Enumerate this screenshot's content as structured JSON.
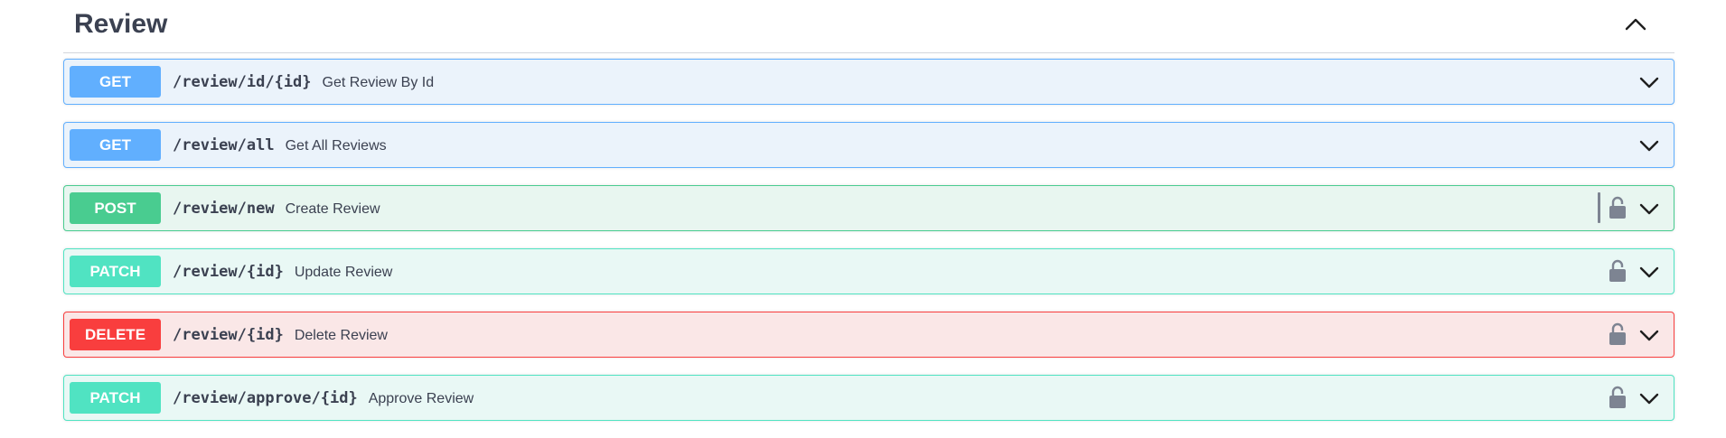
{
  "section": {
    "title": "Review",
    "toggle_icon": "chevron-up-icon"
  },
  "colors": {
    "get": "#61affe",
    "post": "#49cc90",
    "patch": "#50e3c2",
    "delete": "#f93e3e",
    "text": "#3b4151"
  },
  "operations": [
    {
      "method": "GET",
      "path": "/review/id/{id}",
      "summary": "Get Review By Id",
      "locked": false
    },
    {
      "method": "GET",
      "path": "/review/all",
      "summary": "Get All Reviews",
      "locked": false
    },
    {
      "method": "POST",
      "path": "/review/new",
      "summary": "Create Review",
      "locked": true
    },
    {
      "method": "PATCH",
      "path": "/review/{id}",
      "summary": "Update Review",
      "locked": true
    },
    {
      "method": "DELETE",
      "path": "/review/{id}",
      "summary": "Delete Review",
      "locked": true
    },
    {
      "method": "PATCH",
      "path": "/review/approve/{id}",
      "summary": "Approve Review",
      "locked": true
    }
  ]
}
